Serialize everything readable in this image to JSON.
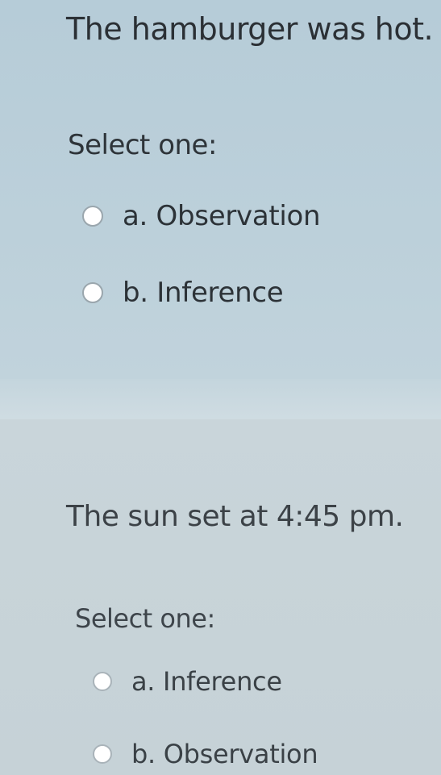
{
  "questions": [
    {
      "text": "The hamburger was hot.",
      "select_label": "Select one:",
      "options": [
        "a. Observation",
        "b. Inference"
      ]
    },
    {
      "text": "The sun set at 4:45 pm.",
      "select_label": "Select one:",
      "options": [
        "a. Inference",
        "b. Observation"
      ]
    }
  ]
}
